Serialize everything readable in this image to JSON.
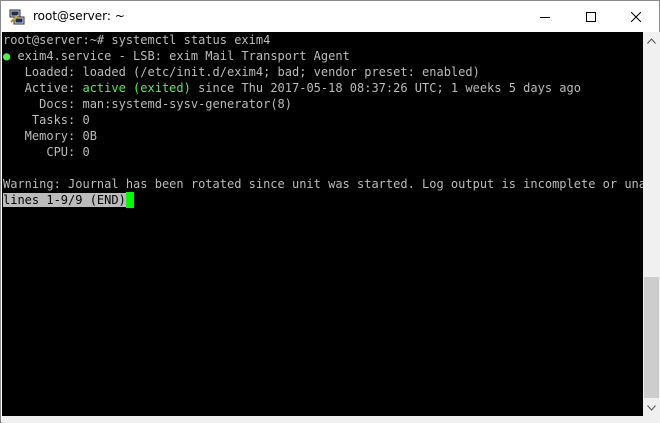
{
  "window": {
    "title": "root@server: ~",
    "app_icon": "putty-icon"
  },
  "terminal": {
    "lines": [
      {
        "prompt": "root@server:~# ",
        "command": "systemctl status exim4"
      },
      {
        "bullet": "●",
        "text": " exim4.service - LSB: exim Mail Transport Agent"
      },
      {
        "label": "   Loaded:",
        "value": " loaded (/etc/init.d/exim4; bad; vendor preset: enabled)"
      },
      {
        "label": "   Active:",
        "status": " active (exited)",
        "value": " since Thu 2017-05-18 08:37:26 UTC; 1 weeks 5 days ago"
      },
      {
        "label": "     Docs:",
        "value": " man:systemd-sysv-generator(8)"
      },
      {
        "label": "    Tasks:",
        "value": " 0"
      },
      {
        "label": "   Memory:",
        "value": " 0B"
      },
      {
        "label": "      CPU:",
        "value": " 0"
      },
      {
        "text": ""
      },
      {
        "text": "Warning: Journal has been rotated since unit was started. Log output is incomplete or unavailable."
      },
      {
        "pager": "lines 1-9/9 (END)"
      }
    ]
  },
  "colors": {
    "terminal_bg": "#000000",
    "terminal_fg": "#bbbbbb",
    "status_green": "#4ef04e",
    "cursor": "#00ff00"
  }
}
